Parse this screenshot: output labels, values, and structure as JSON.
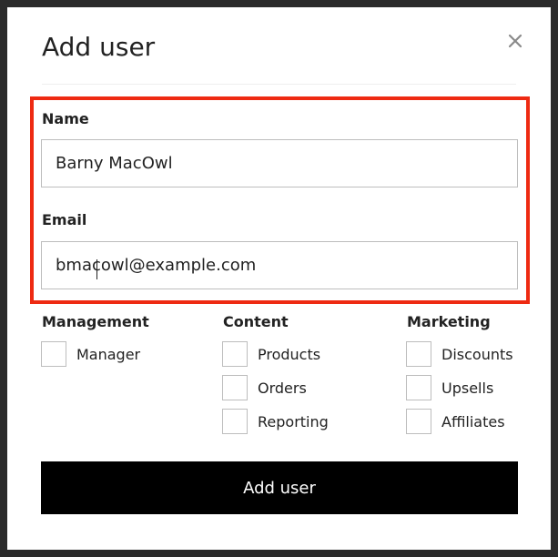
{
  "dialog": {
    "title": "Add user",
    "close_icon": "close-icon"
  },
  "form": {
    "name_label": "Name",
    "name_value": "Barny MacOwl",
    "email_label": "Email",
    "email_value": "bmacowl@example.com"
  },
  "groups": {
    "management": {
      "title": "Management",
      "items": [
        "Manager"
      ]
    },
    "content": {
      "title": "Content",
      "items": [
        "Products",
        "Orders",
        "Reporting"
      ]
    },
    "marketing": {
      "title": "Marketing",
      "items": [
        "Discounts",
        "Upsells",
        "Affiliates"
      ]
    }
  },
  "submit_label": "Add user",
  "colors": {
    "highlight": "#ee2a12",
    "button_bg": "#000000",
    "button_text": "#ffffff",
    "border": "#bdbdbd"
  }
}
